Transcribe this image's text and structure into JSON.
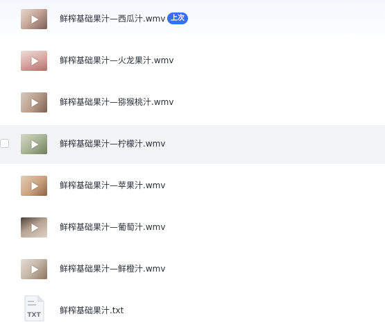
{
  "files": [
    {
      "name": "鲜榨基础果汁—西瓜汁.wmv",
      "type": "video",
      "icon": "video-thumbnail",
      "badge": "上次",
      "colors": [
        "#c8a99a",
        "#7a5d55",
        "#e7d7cf"
      ]
    },
    {
      "name": "鲜榨基础果汁—火龙果汁.wmv",
      "type": "video",
      "icon": "video-thumbnail",
      "colors": [
        "#d9a9a4",
        "#b16f6a",
        "#eedbd8"
      ]
    },
    {
      "name": "鲜榨基础果汁—猕猴桃汁.wmv",
      "type": "video",
      "icon": "video-thumbnail",
      "colors": [
        "#b79a88",
        "#7a6154",
        "#d8c9bd"
      ]
    },
    {
      "name": "鲜榨基础果汁—柠檬汁.wmv",
      "type": "video",
      "icon": "video-thumbnail",
      "hovered": true,
      "colors": [
        "#a9b596",
        "#6e7d5a",
        "#d2d9c4"
      ]
    },
    {
      "name": "鲜榨基础果汁—苹果汁.wmv",
      "type": "video",
      "icon": "video-thumbnail",
      "colors": [
        "#c9a27e",
        "#8a6346",
        "#e4ccb6"
      ]
    },
    {
      "name": "鲜榨基础果汁—葡萄汁.wmv",
      "type": "video",
      "icon": "video-thumbnail",
      "colors": [
        "#b7a392",
        "#4f3e38",
        "#ddd1c6"
      ]
    },
    {
      "name": "鲜榨基础果汁—鲜橙汁.wmv",
      "type": "video",
      "icon": "video-thumbnail",
      "colors": [
        "#c4b6a6",
        "#8d725d",
        "#e6ddd3"
      ]
    },
    {
      "name": "鲜榨基础果汁.txt",
      "type": "txt",
      "icon": "txt-file-icon",
      "icon_label": "TXT"
    }
  ],
  "accent_color": "#3b6cf6"
}
